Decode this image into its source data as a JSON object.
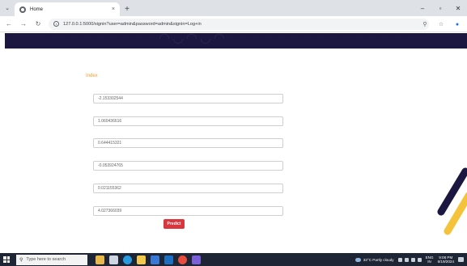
{
  "browser": {
    "tab_title": "Home",
    "tab_close": "×",
    "new_tab": "+",
    "url": "127.0.0.1:5000/signin?user=admin&password=admin&signin=Log+in",
    "window_controls": [
      "–",
      "▫",
      "✕"
    ]
  },
  "page": {
    "label": "Index",
    "fields": [
      "-2.153302544",
      "1.060436616",
      "0.644415321",
      "-0.053924765",
      "0.021155362",
      "4.027366039"
    ],
    "predict_label": "Predict"
  },
  "taskbar": {
    "search_placeholder": "Type here to search",
    "weather": "33°C  Partly cloudy",
    "lang_top": "ENG",
    "lang_bottom": "IN",
    "time": "9:08 PM",
    "date": "6/19/2024"
  },
  "colors": {
    "header_band": "#1c1740",
    "label": "#f0a030",
    "predict_button": "#d9363e",
    "taskbar": "#1e2535"
  },
  "icons": [
    "tab-list-icon",
    "favicon-icon",
    "back-icon",
    "forward-icon",
    "reload-icon",
    "site-info-icon",
    "zoom-icon",
    "star-icon",
    "profile-icon",
    "windows-start-icon",
    "search-icon"
  ]
}
